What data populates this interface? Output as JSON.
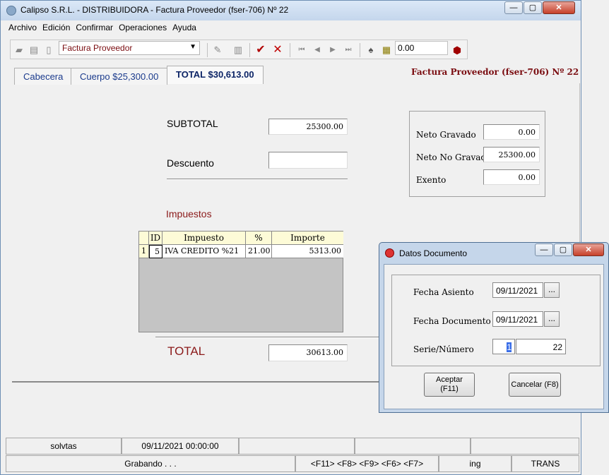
{
  "window": {
    "title": "Calipso S.R.L. - DISTRIBUIDORA  -  Factura Proveedor (fser-706) Nº 22"
  },
  "menu": [
    "Archivo",
    "Edición",
    "Confirmar",
    "Operaciones",
    "Ayuda"
  ],
  "toolbar": {
    "combo_value": "Factura Proveedor",
    "amount": "0.00"
  },
  "tabs": [
    {
      "label": "Cabecera"
    },
    {
      "label": "Cuerpo $25,300.00"
    },
    {
      "label": "TOTAL $30,613.00"
    }
  ],
  "header_right": "Factura Proveedor (fser-706) Nº 22",
  "main": {
    "subtotal_label": "SUBTOTAL",
    "subtotal_value": "25300.00",
    "descuento_label": "Descuento",
    "descuento_value": "",
    "impuestos_label": "Impuestos",
    "total_label": "TOTAL",
    "total_value": "30613.00"
  },
  "neto": {
    "gravado_label": "Neto Gravado",
    "gravado_value": "0.00",
    "no_gravado_label": "Neto No Gravado",
    "no_gravado_value": "25300.00",
    "exento_label": "Exento",
    "exento_value": "0.00"
  },
  "grid": {
    "headers": [
      "ID",
      "Impuesto",
      "%",
      "Importe"
    ],
    "rows": [
      {
        "row": "1",
        "id": "5",
        "impuesto": "IVA CREDITO %21",
        "pct": "21.00",
        "importe": "5313.00"
      }
    ]
  },
  "statusbar": {
    "user": "solvtas",
    "datetime": "09/11/2021 00:00:00",
    "message": "Grabando . . .",
    "keys": "<F11> <F8> <F9> <F6> <F7>",
    "lang": "ing",
    "mode": "TRANS"
  },
  "dialog": {
    "title": "Datos Documento",
    "fecha_asiento_label": "Fecha Asiento",
    "fecha_asiento": "09/11/2021",
    "fecha_documento_label": "Fecha Documento",
    "fecha_documento": "09/11/2021",
    "serie_label": "Serie/Número",
    "serie": "1",
    "numero": "22",
    "dots": "...",
    "accept_line1": "Aceptar",
    "accept_line2": "(F11)",
    "cancel": "Cancelar (F8)"
  },
  "colors": {
    "accent": "#7a0c10",
    "tab_text": "#1a3a8c",
    "grid_header": "#fdfbd7",
    "grid_bg": "#c4c4c4"
  }
}
